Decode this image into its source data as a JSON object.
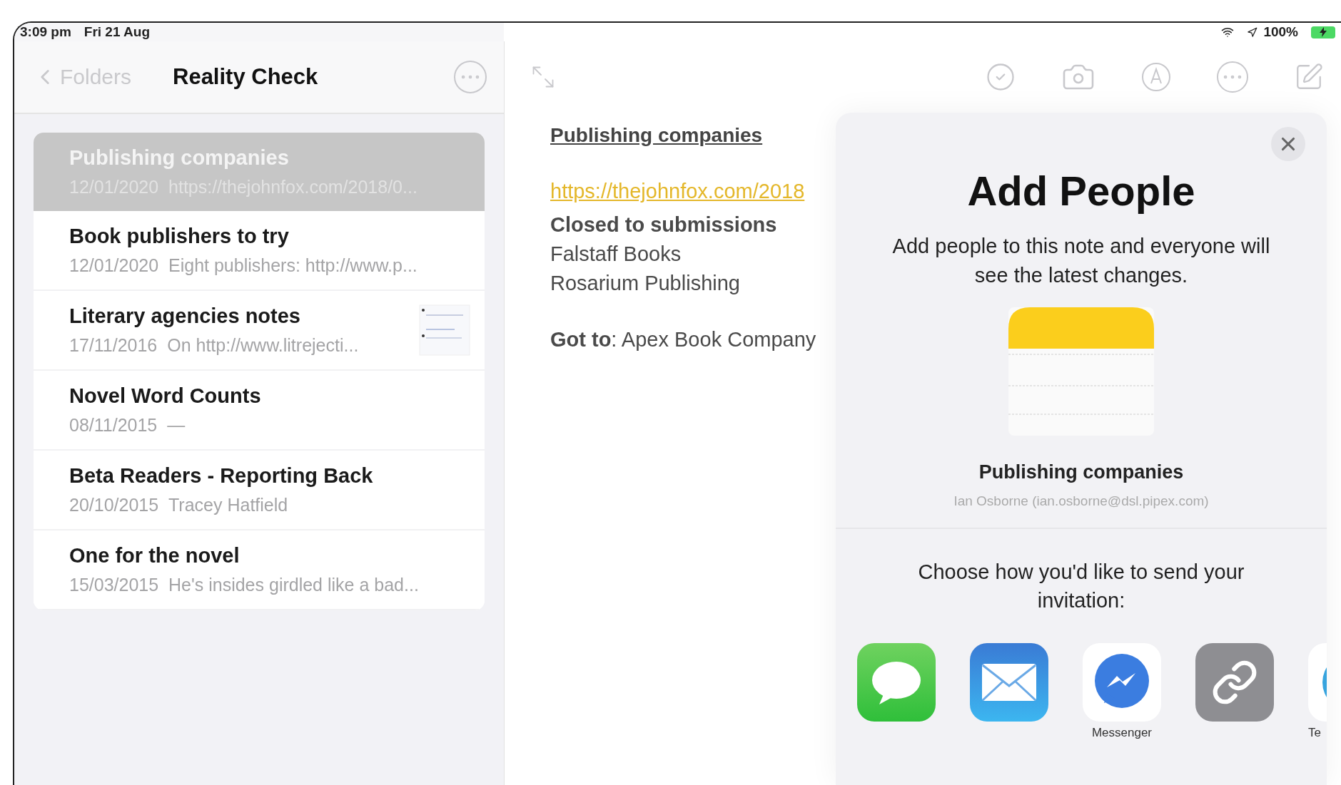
{
  "status_bar": {
    "time": "3:09 pm",
    "date": "Fri 21 Aug",
    "battery": "100%"
  },
  "sidebar": {
    "back_label": "Folders",
    "title": "Reality Check",
    "notes": [
      {
        "title": "Publishing companies",
        "date": "12/01/2020",
        "preview": "https://thejohnfox.com/2018/0...",
        "selected": true,
        "has_thumbnail": false
      },
      {
        "title": "Book publishers to try",
        "date": "12/01/2020",
        "preview": "Eight publishers: http://www.p...",
        "selected": false,
        "has_thumbnail": false
      },
      {
        "title": "Literary agencies notes",
        "date": "17/11/2016",
        "preview": "On http://www.litrejecti...",
        "selected": false,
        "has_thumbnail": true
      },
      {
        "title": "Novel Word Counts",
        "date": "08/11/2015",
        "preview": "—",
        "selected": false,
        "has_thumbnail": false
      },
      {
        "title": "Beta Readers - Reporting Back",
        "date": "20/10/2015",
        "preview": "Tracey Hatfield",
        "selected": false,
        "has_thumbnail": false
      },
      {
        "title": "One for the novel",
        "date": "15/03/2015",
        "preview": "He's insides girdled like a bad...",
        "selected": false,
        "has_thumbnail": false
      }
    ]
  },
  "note": {
    "title": "Publishing companies",
    "link": "https://thejohnfox.com/2018",
    "paragraphs": [
      {
        "lines": [
          {
            "text": "Closed to submissions",
            "bold": true
          },
          {
            "text": "Falstaff Books",
            "bold": false
          },
          {
            "text": "Rosarium Publishing",
            "bold": false
          }
        ]
      },
      {
        "lines": [
          {
            "text": "**Got to**: Apex Book Company",
            "bold": false
          }
        ]
      }
    ]
  },
  "share_panel": {
    "title": "Add People",
    "description": "Add people to this note and everyone will see the latest changes.",
    "note_title": "Publishing companies",
    "owner": "Ian Osborne (ian.osborne@dsl.pipex.com)",
    "prompt": "Choose how you'd like to send your invitation:",
    "apps": [
      {
        "kind": "messages"
      },
      {
        "kind": "mail"
      },
      {
        "kind": "messenger",
        "label": "Messenger"
      },
      {
        "kind": "link"
      },
      {
        "kind": "partial",
        "label": "Te"
      }
    ]
  }
}
